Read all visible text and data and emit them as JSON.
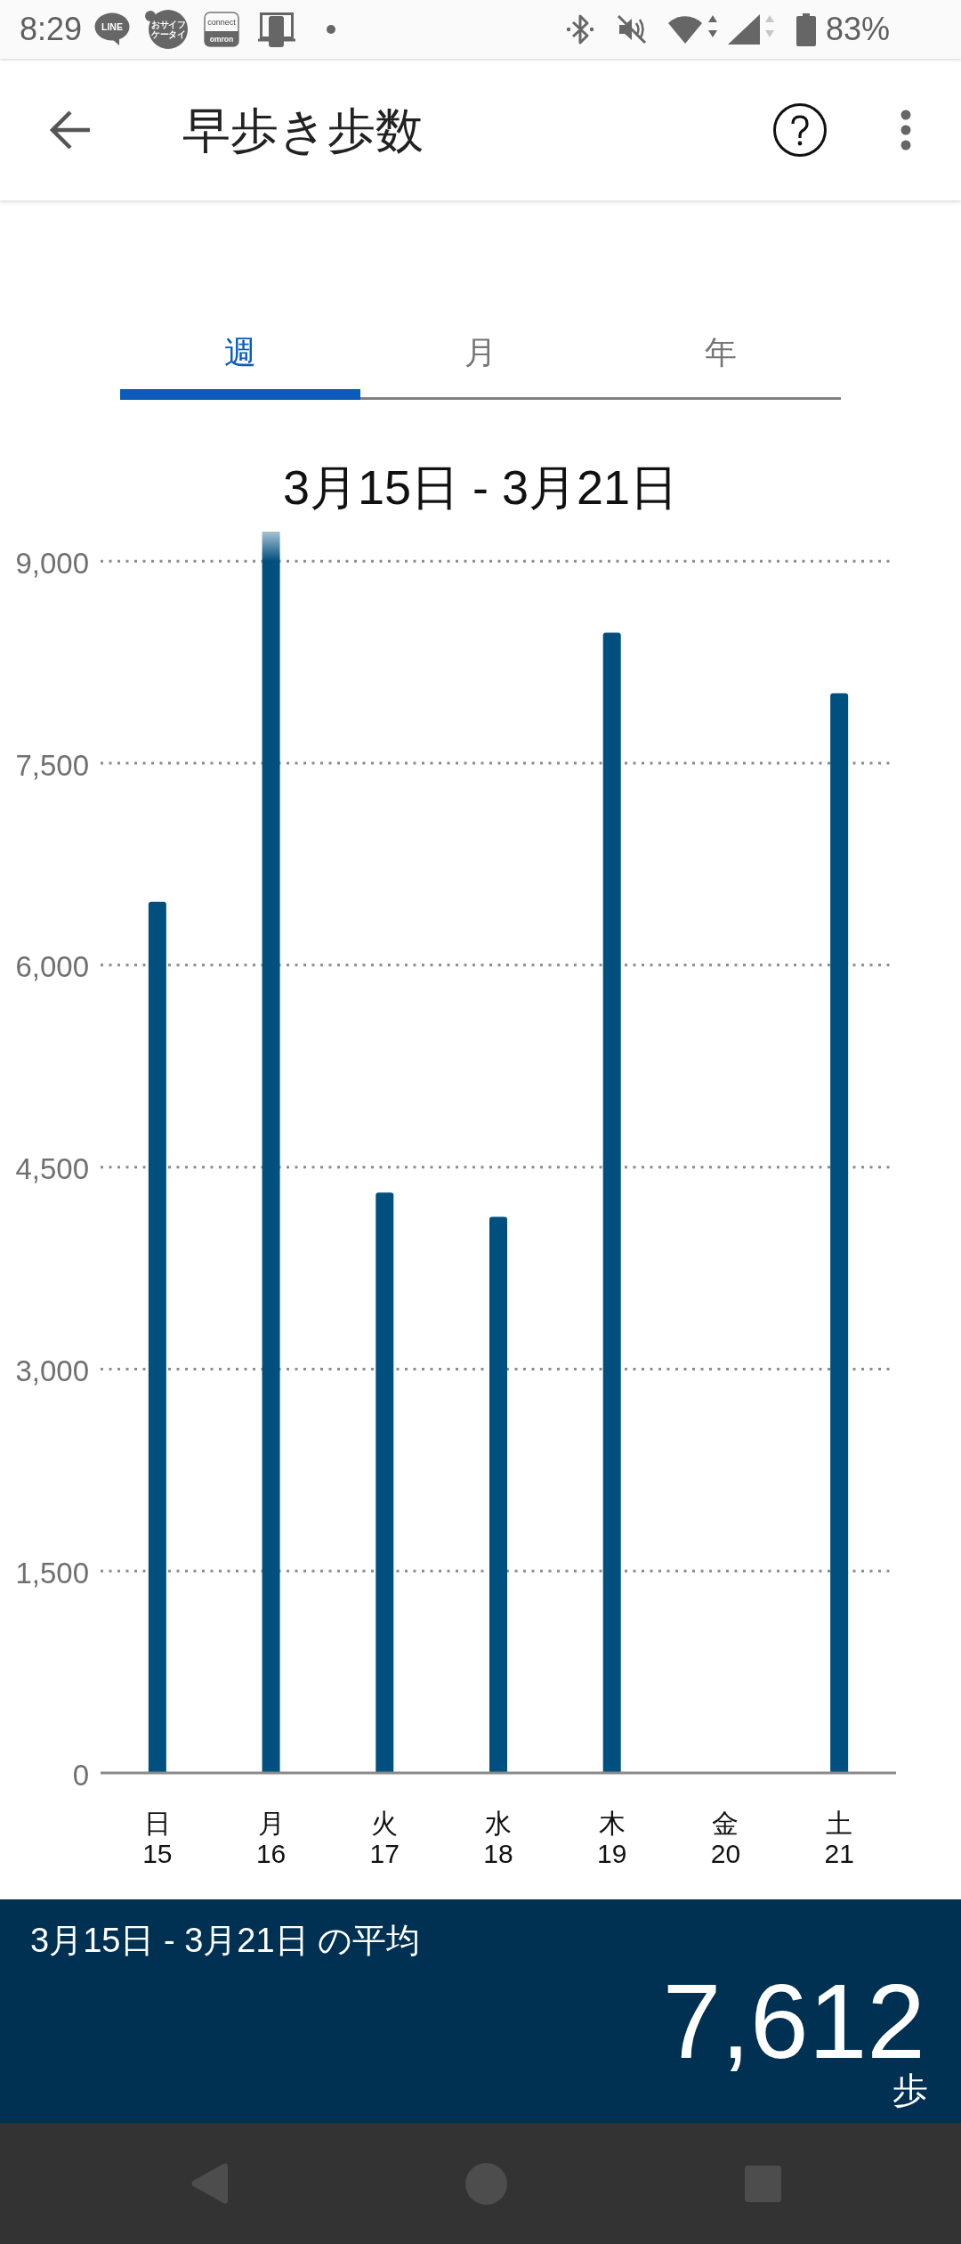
{
  "status_bar": {
    "time": "8:29",
    "notifications": [
      {
        "kind": "bubble",
        "lines": [
          "LINE"
        ]
      },
      {
        "kind": "badge",
        "lines": [
          "おサイフ",
          "ケータイ"
        ]
      },
      {
        "kind": "tile",
        "lines": [
          "connect",
          "omron"
        ]
      },
      {
        "kind": "device"
      },
      {
        "kind": "dot"
      }
    ],
    "battery": "83%"
  },
  "app_bar": {
    "title": "早歩き歩数"
  },
  "tabs": [
    {
      "label": "週",
      "selected": true
    },
    {
      "label": "月",
      "selected": false
    },
    {
      "label": "年",
      "selected": false
    }
  ],
  "period_title": "3月15日 - 3月21日",
  "chart": {
    "chart_data": {
      "type": "bar",
      "categories": [
        "日\n15",
        "月\n16",
        "火\n17",
        "水\n18",
        "木\n19",
        "金\n20",
        "土\n21"
      ],
      "series": [
        {
          "color": "#00507f",
          "values": [
            6470,
            9220,
            4310,
            4130,
            8470,
            null,
            8020
          ]
        }
      ],
      "ylim": [
        0,
        9220
      ],
      "yticks": [
        0,
        {
          "value": 1500,
          "label": "1,500"
        },
        {
          "value": 3000,
          "label": "3,000"
        },
        {
          "value": 4500,
          "label": "4,500"
        },
        {
          "value": 6000,
          "label": "6,000"
        },
        {
          "value": 7500,
          "label": "7,500"
        },
        {
          "value": 9000,
          "label": "9,000"
        }
      ],
      "grid": true
    }
  },
  "summary": {
    "label": "3月15日 - 3月21日 の平均",
    "value": "7,612",
    "unit": "歩"
  }
}
